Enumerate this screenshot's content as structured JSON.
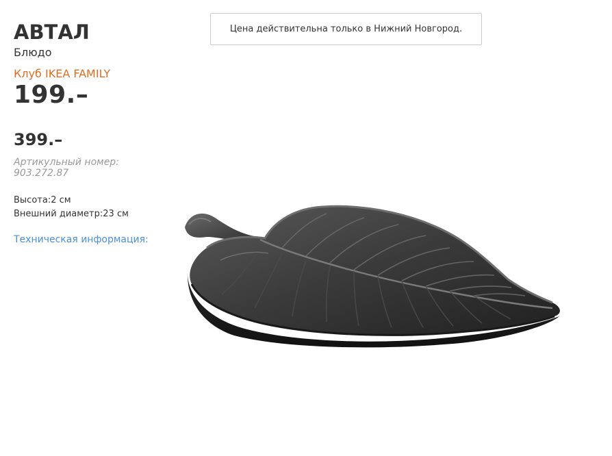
{
  "product": {
    "name": "АВТАЛ",
    "type": "Блюдо",
    "family_label": "Клуб IKEA FAMILY",
    "family_price": "199.–",
    "regular_price": "399.–",
    "article_label": "Артикульный номер:",
    "article_number": "903.272.87",
    "height_label": "Высота:",
    "height_value": "2 см",
    "diameter_label": "Внешний диаметр:",
    "diameter_value": "23 см",
    "tech_info_link": "Техническая информация:"
  },
  "notice": {
    "text": "Цена действительна только в Нижний Новгород."
  },
  "colors": {
    "family_accent": "#e06d1f",
    "link": "#4a90d9",
    "text": "#333333",
    "muted": "#999999"
  },
  "image": {
    "icon": "leaf-plate-image"
  }
}
